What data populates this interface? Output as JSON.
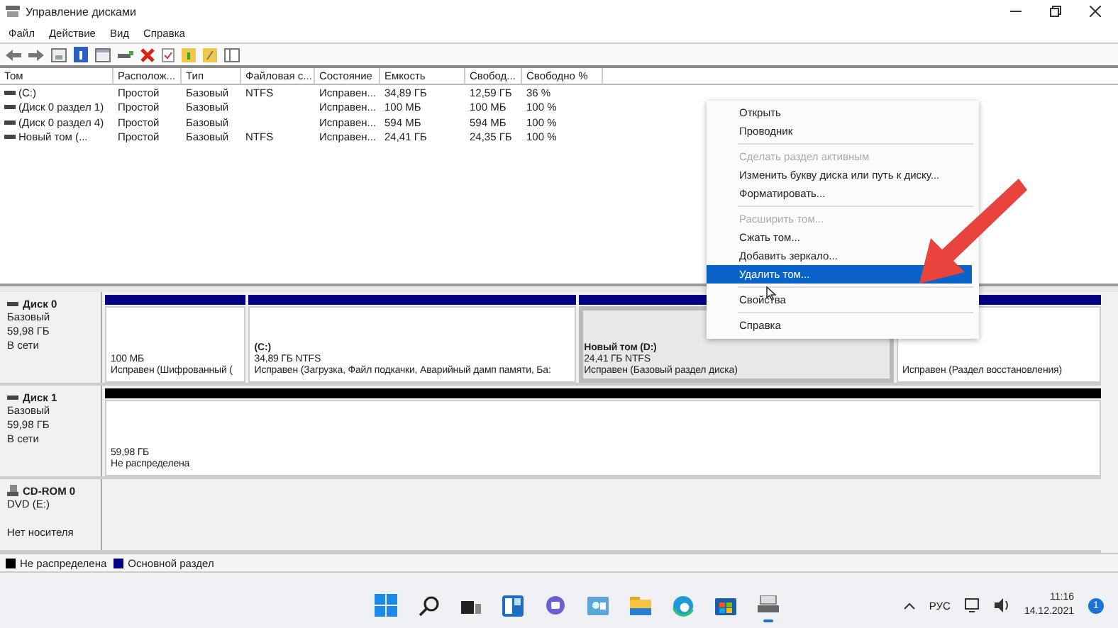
{
  "window": {
    "title": "Управление дисками"
  },
  "menu": [
    "Файл",
    "Действие",
    "Вид",
    "Справка"
  ],
  "table": {
    "columns": [
      "Том",
      "Располож...",
      "Тип",
      "Файловая с...",
      "Состояние",
      "Емкость",
      "Свобод...",
      "Свободно %"
    ],
    "rows": [
      [
        "(C:)",
        "Простой",
        "Базовый",
        "NTFS",
        "Исправен...",
        "34,89 ГБ",
        "12,59 ГБ",
        "36 %"
      ],
      [
        "(Диск 0 раздел 1)",
        "Простой",
        "Базовый",
        "",
        "Исправен...",
        "100 МБ",
        "100 МБ",
        "100 %"
      ],
      [
        "(Диск 0 раздел 4)",
        "Простой",
        "Базовый",
        "",
        "Исправен...",
        "594 МБ",
        "594 МБ",
        "100 %"
      ],
      [
        "Новый том (...",
        "Простой",
        "Базовый",
        "NTFS",
        "Исправен...",
        "24,41 ГБ",
        "24,35 ГБ",
        "100 %"
      ]
    ]
  },
  "disks": [
    {
      "kind": "disk",
      "name": "Диск 0",
      "lines": [
        "Базовый",
        "59,98 ГБ",
        "В сети"
      ],
      "partitions": [
        {
          "size": "100 МБ",
          "status": "Исправен (Шифрованный (",
          "color": "#000080",
          "selected": false
        },
        {
          "name": "(C:)",
          "size": "34,89 ГБ NTFS",
          "status": "Исправен (Загрузка, Файл подкачки, Аварийный дамп памяти, Ба:",
          "color": "#000080",
          "selected": false
        },
        {
          "name": "Новый том  (D:)",
          "size": "24,41 ГБ NTFS",
          "status": "Исправен (Базовый раздел диска)",
          "color": "#000080",
          "selected": true
        },
        {
          "status": "Исправен (Раздел восстановления)",
          "color": "#000080",
          "selected": false
        }
      ]
    },
    {
      "kind": "disk",
      "name": "Диск 1",
      "lines": [
        "Базовый",
        "59,98 ГБ",
        "В сети"
      ],
      "partitions": [
        {
          "size": "59,98 ГБ",
          "status": "Не распределена",
          "color": "#000000",
          "selected": false
        }
      ]
    },
    {
      "kind": "cdrom",
      "name": "CD-ROM 0",
      "lines": [
        "DVD (E:)",
        "Нет носителя"
      ]
    }
  ],
  "legend": [
    {
      "label": "Не распределена",
      "color": "#000000"
    },
    {
      "label": "Основной раздел",
      "color": "#000080"
    }
  ],
  "context_menu": [
    {
      "kind": "item",
      "label": "Открыть",
      "disabled": false,
      "selected": false
    },
    {
      "kind": "item",
      "label": "Проводник",
      "disabled": false,
      "selected": false
    },
    {
      "kind": "separator"
    },
    {
      "kind": "item",
      "label": "Сделать раздел активным",
      "disabled": true,
      "selected": false
    },
    {
      "kind": "item",
      "label": "Изменить букву диска или путь к диску...",
      "disabled": false,
      "selected": false
    },
    {
      "kind": "item",
      "label": "Форматировать...",
      "disabled": false,
      "selected": false
    },
    {
      "kind": "separator"
    },
    {
      "kind": "item",
      "label": "Расширить том...",
      "disabled": true,
      "selected": false
    },
    {
      "kind": "item",
      "label": "Сжать том...",
      "disabled": false,
      "selected": false
    },
    {
      "kind": "item",
      "label": "Добавить зеркало...",
      "disabled": false,
      "selected": false
    },
    {
      "kind": "item",
      "label": "Удалить том...",
      "disabled": false,
      "selected": true
    },
    {
      "kind": "separator"
    },
    {
      "kind": "item",
      "label": "Свойства",
      "disabled": false,
      "selected": false
    },
    {
      "kind": "separator"
    },
    {
      "kind": "item",
      "label": "Справка",
      "disabled": false,
      "selected": false
    }
  ],
  "taskbar": {
    "language": "РУС",
    "time": "11:16",
    "date": "14.12.2021",
    "notifications": "1"
  }
}
